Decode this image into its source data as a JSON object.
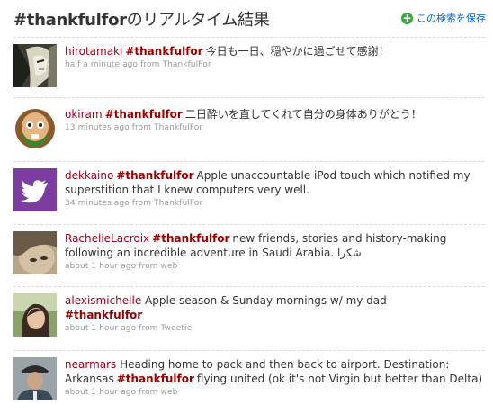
{
  "header": {
    "hashtag": "#thankfulfor",
    "title_suffix": "のリアルタイム結果",
    "save_label": "この検索を保存"
  },
  "tweets": [
    {
      "user": "hirotamaki",
      "hashtag": "#thankfulfor",
      "text": "今日も一日、穏やかに過ごせて感謝！",
      "time": "half a minute ago",
      "from_word": "from",
      "source": "ThankfulFor"
    },
    {
      "user": "okiram",
      "hashtag": "#thankfulfor",
      "text": "二日酔いを直してくれて自分の身体ありがとう！",
      "time": "13 minutes ago",
      "from_word": "from",
      "source": "ThankfulFor"
    },
    {
      "user": "dekkaino",
      "hashtag": "#thankfulfor",
      "text": "Apple unaccountable iPod touch which notified my superstition that I knew computers very well.",
      "time": "34 minutes ago",
      "from_word": "from",
      "source": "ThankfulFor"
    },
    {
      "user": "RachelleLacroix",
      "hashtag": "#thankfulfor",
      "text": "new friends, stories and history-making following an incredible adventure in Saudi Arabia. شكرا",
      "time": "about 1 hour ago",
      "from_word": "from",
      "source": "web"
    },
    {
      "user": "alexismichelle",
      "text_before": "Apple season & Sunday mornings w/ my dad",
      "hashtag": "#thankfulfor",
      "time": "about 1 hour ago",
      "from_word": "from",
      "source": "Tweetie"
    },
    {
      "user": "nearmars",
      "text_before": "Heading home to pack and then back to airport. Destination: Arkansas",
      "hashtag": "#thankfulfor",
      "text": "flying united (ok it's not Virgin but better than Delta)",
      "time": "about 1 hour ago",
      "from_word": "from",
      "source": "web"
    }
  ]
}
